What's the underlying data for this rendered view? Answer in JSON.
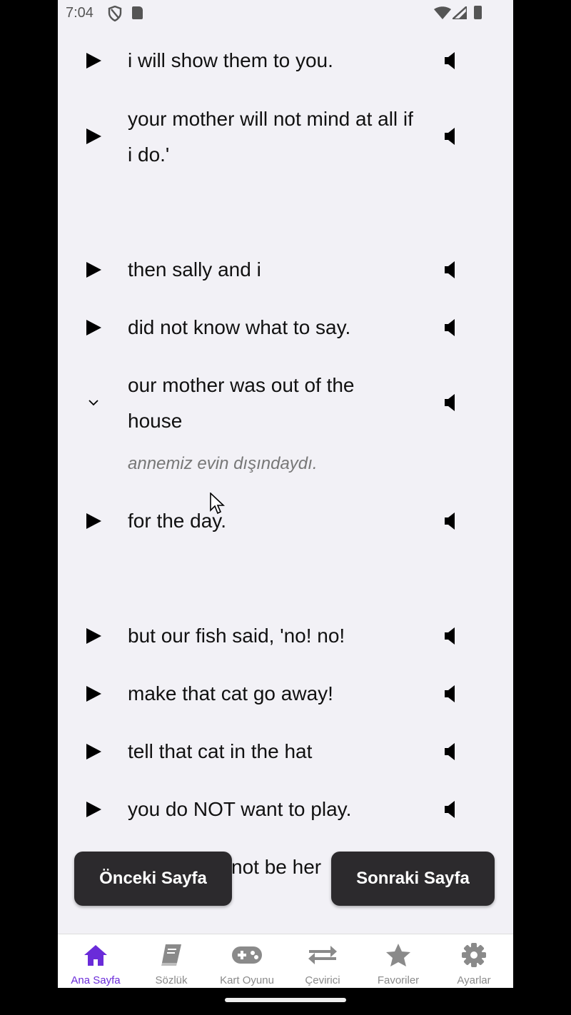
{
  "status_bar": {
    "time": "7:04"
  },
  "lines": [
    {
      "text": "i will show them to you."
    },
    {
      "text": "your mother will not mind at all if i do.'"
    },
    {
      "text": "then sally and i"
    },
    {
      "text": "did not know what to say."
    },
    {
      "text": "our mother was out of the house",
      "translation": "annemiz evin dışındaydı."
    },
    {
      "text": "for the day."
    },
    {
      "text": "but our fish said, 'no! no!"
    },
    {
      "text": "make that cat go away!"
    },
    {
      "text": "tell that cat in the hat"
    },
    {
      "text": "you do NOT want to play."
    },
    {
      "text": "not be her"
    }
  ],
  "pager": {
    "prev_label": "Önceki Sayfa",
    "next_label": "Sonraki Sayfa"
  },
  "bottom_nav": {
    "items": [
      {
        "label": "Ana Sayfa",
        "icon": "home-icon",
        "active": true
      },
      {
        "label": "Sözlük",
        "icon": "book-icon"
      },
      {
        "label": "Kart Oyunu",
        "icon": "gamepad-icon"
      },
      {
        "label": "Çevirici",
        "icon": "swap-arrows-icon"
      },
      {
        "label": "Favoriler",
        "icon": "star-icon"
      },
      {
        "label": "Ayarlar",
        "icon": "gear-icon"
      }
    ]
  },
  "colors": {
    "accent": "#6a2bd9",
    "button_bg": "#2c2a2d",
    "page_bg": "#f2f1f6"
  }
}
